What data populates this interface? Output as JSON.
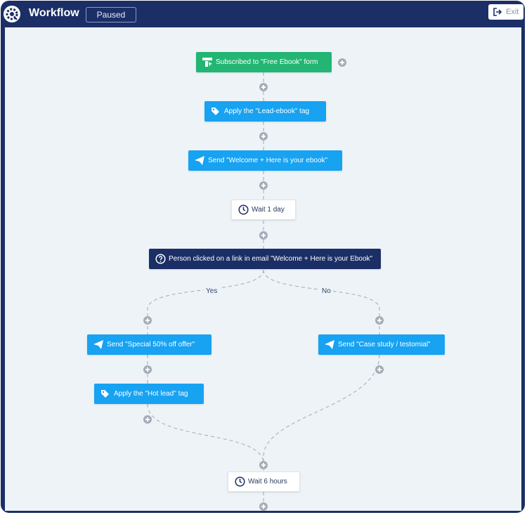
{
  "header": {
    "title": "Workflow",
    "status": "Paused",
    "exit_label": "Exit"
  },
  "icons": {
    "logo": "gear-refresh-logo",
    "exit": "exit-icon",
    "trigger": "form-icon",
    "tag": "tag-icon",
    "email": "paper-plane-icon",
    "wait": "clock-icon",
    "condition": "question-circle-icon",
    "add": "plus-circle-icon"
  },
  "colors": {
    "header": "#1b2f66",
    "canvas": "#eef3f8",
    "trigger": "#22b573",
    "action": "#17a2f2",
    "condition": "#1b2f66",
    "wait": "#ffffff",
    "plus": "#a6adb8"
  },
  "workflow": {
    "trigger": "Subscribed to \"Free Ebook\" form",
    "tag_lead": "Apply the \"Lead-ebook\" tag",
    "send_welcome": "Send \"Welcome + Here is your ebook\"",
    "wait_1_day": "Wait 1 day",
    "condition": "Person clicked on a link in email \"Welcome + Here is your Ebook\"",
    "yes_label": "Yes",
    "no_label": "No",
    "yes_send": "Send \"Special 50% off offer\"",
    "yes_tag": "Apply the \"Hot lead\" tag",
    "no_send": "Send \"Case study / testomial\"",
    "wait_6_hours": "Wait 6 hours"
  }
}
